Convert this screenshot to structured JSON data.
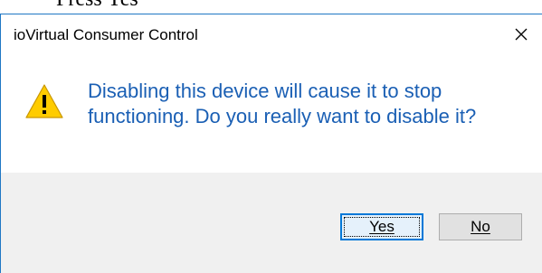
{
  "document": {
    "step_text": "Press Yes"
  },
  "dialog": {
    "title": "ioVirtual Consumer Control",
    "close_label": "✕",
    "icon": "warning-triangle-icon",
    "message": "Disabling this device will cause it to stop functioning. Do you really want to disable it?",
    "buttons": {
      "yes_label": "Yes",
      "no_label": "No"
    },
    "default_button": "yes"
  },
  "colors": {
    "message_text": "#1a5fb4",
    "window_border": "#1f77c4",
    "footer_bg": "#f0f0f0",
    "default_button_border": "#0078d7",
    "warning_fill": "#ffcc00"
  }
}
